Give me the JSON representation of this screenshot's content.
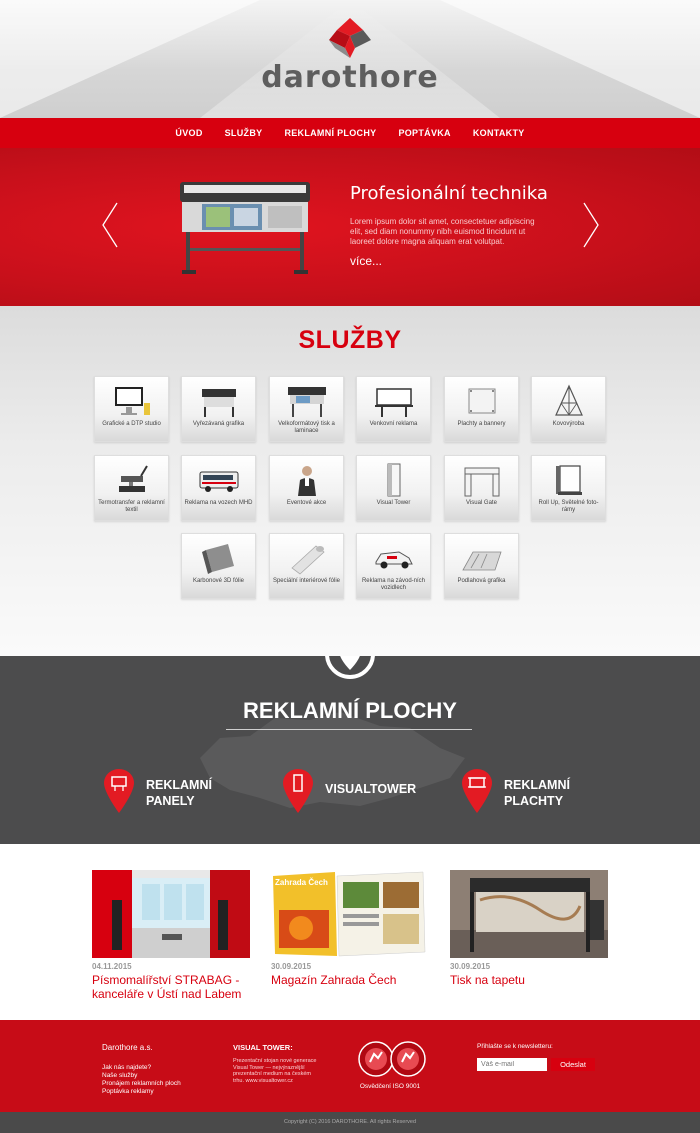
{
  "brand": {
    "name": "darothore",
    "colors": {
      "red": "#d7000f",
      "dark": "#4c4c4d",
      "gray": "#5e5e5e"
    }
  },
  "nav": {
    "items": [
      "ÚVOD",
      "SLUŽBY",
      "REKLAMNÍ PLOCHY",
      "POPTÁVKA",
      "KONTAKTY"
    ]
  },
  "slider": {
    "title": "Profesionální technika",
    "text": "Lorem ipsum dolor sit amet, consectetuer adipiscing elit, sed diam nonummy nibh euismod tincidunt ut laoreet dolore magna aliquam erat volutpat.",
    "more": "více..."
  },
  "services": {
    "title": "SLUŽBY",
    "items": [
      {
        "label": "Grafické a DTP studio",
        "icon": "monitor-icon"
      },
      {
        "label": "Vyřezávaná grafika",
        "icon": "cutter-icon"
      },
      {
        "label": "Velkoformátový tisk a laminace",
        "icon": "printer-icon"
      },
      {
        "label": "Venkovní reklama",
        "icon": "billboard-icon"
      },
      {
        "label": "Plachty a bannery",
        "icon": "banner-icon"
      },
      {
        "label": "Kovovýroba",
        "icon": "truss-icon"
      },
      {
        "label": "Termotransfer a reklamní textil",
        "icon": "heat-press-icon"
      },
      {
        "label": "Reklama na vozech MHD",
        "icon": "bus-icon"
      },
      {
        "label": "Eventové akce",
        "icon": "person-icon"
      },
      {
        "label": "Visual Tower",
        "icon": "tower-icon"
      },
      {
        "label": "Visual Gate",
        "icon": "gate-icon"
      },
      {
        "label": "Roll Up, Světelné foto-rámy",
        "icon": "rollup-icon"
      },
      {
        "label": "Karbonové 3D fólie",
        "icon": "carbon-foil-icon"
      },
      {
        "label": "Speciální interiérové fólie",
        "icon": "foil-roll-icon"
      },
      {
        "label": "Reklama na závod-ních vozidlech",
        "icon": "race-car-icon"
      },
      {
        "label": "Podlahová grafika",
        "icon": "floor-graphic-icon"
      }
    ]
  },
  "plochy": {
    "title": "REKLAMNÍ PLOCHY",
    "items": [
      {
        "line1": "REKLAMNÍ",
        "line2": "PANELY",
        "icon": "panel-pin-icon"
      },
      {
        "line1": "VISUALTOWER",
        "line2": "",
        "icon": "tower-pin-icon"
      },
      {
        "line1": "REKLAMNÍ",
        "line2": "PLACHTY",
        "icon": "banner-pin-icon"
      }
    ]
  },
  "news": [
    {
      "date": "04.11.2015",
      "title": "Písmomalířství STRABAG - kanceláře v Ústí nad Labem"
    },
    {
      "date": "30.09.2015",
      "title": "Magazín Zahrada Čech"
    },
    {
      "date": "30.09.2015",
      "title": "Tisk na tapetu"
    }
  ],
  "footer": {
    "company": "Darothore a.s.",
    "links": [
      "Jak nás najdete?",
      "Naše služby",
      "Pronájem reklamních ploch",
      "Poptávka reklamy"
    ],
    "vt_title": "VISUAL TOWER:",
    "vt_text": "Prezentační stojan nové generace Visual Tower — nejvýraznější prezentační medium na českém trhu. www.visualtower.cz",
    "iso": "Osvědčení ISO 9001",
    "newsletter_label": "Přihlašte se k newsletteru:",
    "newsletter_placeholder": "Váš e-mail",
    "newsletter_button": "Odeslat"
  },
  "copyright": "Copyright (C) 2016 DAROTHORE. All rights Reserved",
  "magazine_cover": "Zahrada Čech"
}
